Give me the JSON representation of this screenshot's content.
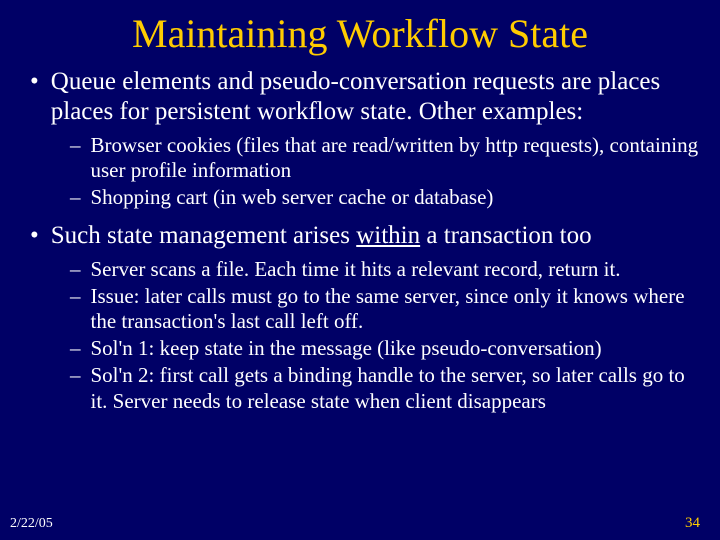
{
  "title": "Maintaining Workflow State",
  "bullets": [
    {
      "text": "Queue elements and pseudo-conversation requests are places places for persistent workflow state. Other examples:",
      "subs": [
        "Browser cookies (files that are read/written by http requests), containing user profile information",
        "Shopping cart (in web server cache or database)"
      ]
    },
    {
      "text_before": "Such state management arises ",
      "text_underline": "within",
      "text_after": " a transaction too",
      "subs": [
        "Server scans a file. Each time it hits a relevant record, return it.",
        "Issue: later calls must go to the same server, since only it knows where the transaction's last call left off.",
        "Sol'n 1: keep state in the message (like pseudo-conversation)",
        "Sol'n 2: first call gets a binding handle to the server, so later calls go to it. Server needs to release state when client disappears"
      ]
    }
  ],
  "footer": {
    "date": "2/22/05",
    "page": "34"
  }
}
